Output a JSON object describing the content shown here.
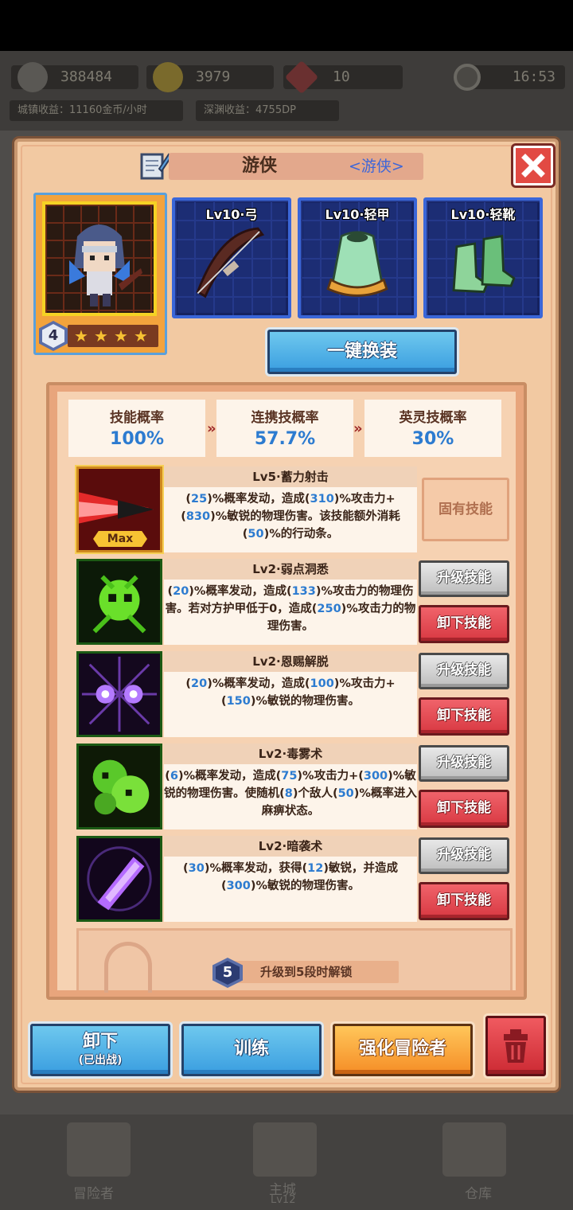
{
  "background": {
    "resources": [
      {
        "name": "power",
        "value": "388484"
      },
      {
        "name": "gold",
        "value": "3979"
      },
      {
        "name": "gem",
        "value": "10"
      }
    ],
    "time": "16:53",
    "town_income": "城镇收益：11160金币/小时",
    "abyss_income": "深渊收益：4755DP",
    "nav": [
      {
        "label": "冒险者"
      },
      {
        "label": "主城",
        "sub": "Lv12"
      },
      {
        "label": "仓库"
      }
    ]
  },
  "dialog": {
    "title": "游侠",
    "class_tag": "<游侠>",
    "rank": "4",
    "stars": 4,
    "equipment": [
      {
        "label": "Lv10·弓",
        "icon": "bow-icon"
      },
      {
        "label": "Lv10·轻甲",
        "icon": "light-armor-icon"
      },
      {
        "label": "Lv10·轻靴",
        "icon": "light-boots-icon"
      }
    ],
    "one_click_equip": "一键换装",
    "rates": [
      {
        "label": "技能概率",
        "value": "100%"
      },
      {
        "label": "连携技概率",
        "value": "57.7%"
      },
      {
        "label": "英灵技概率",
        "value": "30%"
      }
    ],
    "rate_arrow": "»",
    "max_label": "Max",
    "skills": [
      {
        "title": "Lv5·蓄力射击",
        "desc": [
          "(",
          "25",
          ")%概率发动，造成(",
          "310",
          ")%攻击力+(",
          "830",
          ")%敏锐的物理伤害。该技能额外消耗(",
          "50",
          ")%的行动条。"
        ],
        "innate": "固有技能",
        "icon": "charged-shot-icon"
      },
      {
        "title": "Lv2·弱点洞悉",
        "desc": [
          "(",
          "20",
          ")%概率发动，造成(",
          "133",
          ")%攻击力的物理伤害。若对方护甲低于0，造成(",
          "250",
          ")%攻击力的物理伤害。"
        ],
        "upgrade": "升级技能",
        "remove": "卸下技能",
        "icon": "weakness-insight-icon"
      },
      {
        "title": "Lv2·恩赐解脱",
        "desc": [
          "(",
          "20",
          ")%概率发动，造成(",
          "100",
          ")%攻击力+(",
          "150",
          ")%敏锐的物理伤害。"
        ],
        "upgrade": "升级技能",
        "remove": "卸下技能",
        "icon": "mercy-release-icon"
      },
      {
        "title": "Lv2·毒雾术",
        "desc": [
          "(",
          "6",
          ")%概率发动，造成(",
          "75",
          ")%攻击力+(",
          "300",
          ")%敏锐的物理伤害。使随机(",
          "8",
          ")个敌人(",
          "50",
          ")%概率进入麻痹状态。"
        ],
        "upgrade": "升级技能",
        "remove": "卸下技能",
        "icon": "poison-fog-icon"
      },
      {
        "title": "Lv2·暗袭术",
        "desc": [
          "(",
          "30",
          ")%概率发动，获得(",
          "12",
          ")敏锐，并造成(",
          "300",
          ")%敏锐的物理伤害。"
        ],
        "upgrade": "升级技能",
        "remove": "卸下技能",
        "icon": "shadow-strike-icon"
      }
    ],
    "locked_badge": "5",
    "locked_hint": "升级到5段时解锁",
    "buttons": {
      "unequip": "卸下",
      "unequip_sub": "(已出战)",
      "train": "训练",
      "enhance": "强化冒险者"
    }
  },
  "colors": {
    "highlight_number": "#2c7bd0",
    "upgrade_button": "#d6d6d6",
    "remove_button": "#e04a52",
    "enhance_button": "#f8a83a",
    "blue_button": "#55b4ea"
  }
}
